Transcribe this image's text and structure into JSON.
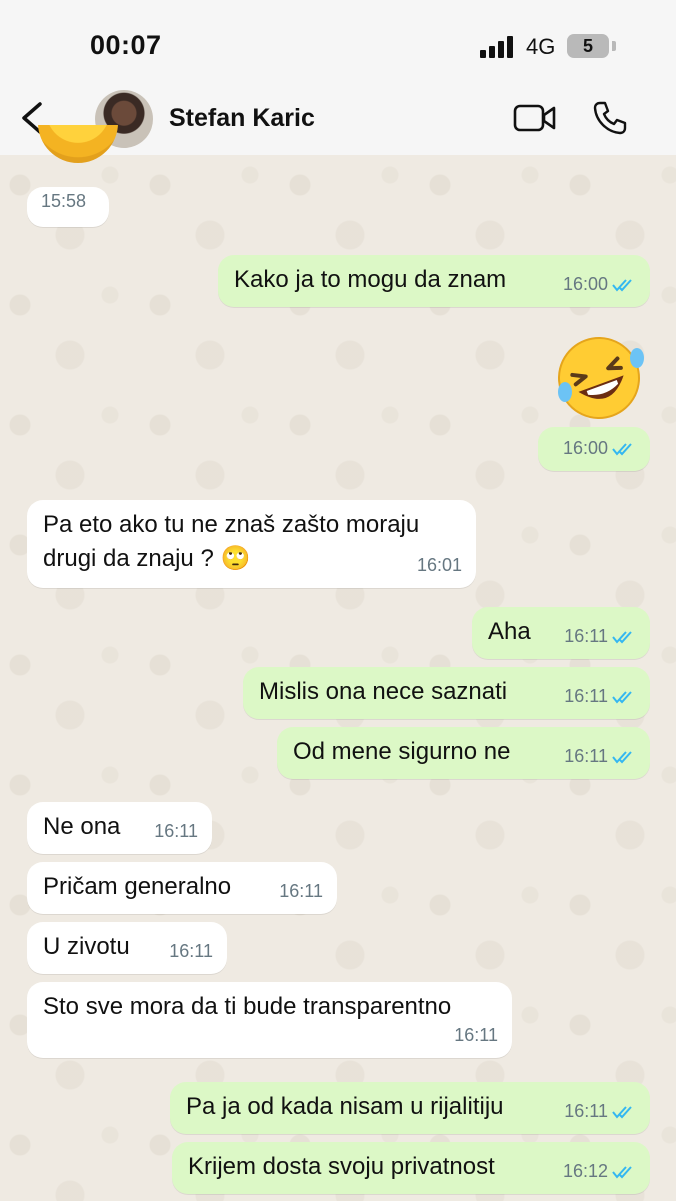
{
  "status_bar": {
    "time": "00:07",
    "network": "4G",
    "battery": "5"
  },
  "header": {
    "contact_name": "Stefan Karic"
  },
  "messages": [
    {
      "dir": "in",
      "text": "",
      "time": "15:58"
    },
    {
      "dir": "out",
      "text": "Kako ja to mogu da znam",
      "time": "16:00",
      "read": true
    },
    {
      "dir": "out",
      "text": "🤣",
      "time": "16:00",
      "read": true,
      "emoji_only": true
    },
    {
      "dir": "in",
      "text_line1": "Pa eto ako tu ne znaš zašto moraju",
      "text_line2": "drugi da znaju ? 🙄",
      "time": "16:01"
    },
    {
      "dir": "out",
      "text": "Aha",
      "time": "16:11",
      "read": true
    },
    {
      "dir": "out",
      "text": "Mislis ona nece saznati",
      "time": "16:11",
      "read": true
    },
    {
      "dir": "out",
      "text": "Od mene sigurno ne",
      "time": "16:11",
      "read": true
    },
    {
      "dir": "in",
      "text": "Ne ona",
      "time": "16:11"
    },
    {
      "dir": "in",
      "text": "Pričam generalno",
      "time": "16:11"
    },
    {
      "dir": "in",
      "text": "U zivotu",
      "time": "16:11"
    },
    {
      "dir": "in",
      "text": "Sto sve mora da ti bude transparentno",
      "time": "16:11"
    },
    {
      "dir": "out",
      "text": "Pa ja od kada nisam u rijalitiju",
      "time": "16:11",
      "read": true
    },
    {
      "dir": "out",
      "text": "Krijem dosta svoju privatnost",
      "time": "16:12",
      "read": true
    }
  ],
  "colors": {
    "outgoing": "#dcf8c6",
    "incoming": "#ffffff",
    "read_ticks": "#34b7f1",
    "time": "#667781"
  },
  "icons": [
    "back-chevron-icon",
    "video-call-icon",
    "phone-icon",
    "double-check-icon",
    "signal-icon",
    "battery-icon"
  ]
}
